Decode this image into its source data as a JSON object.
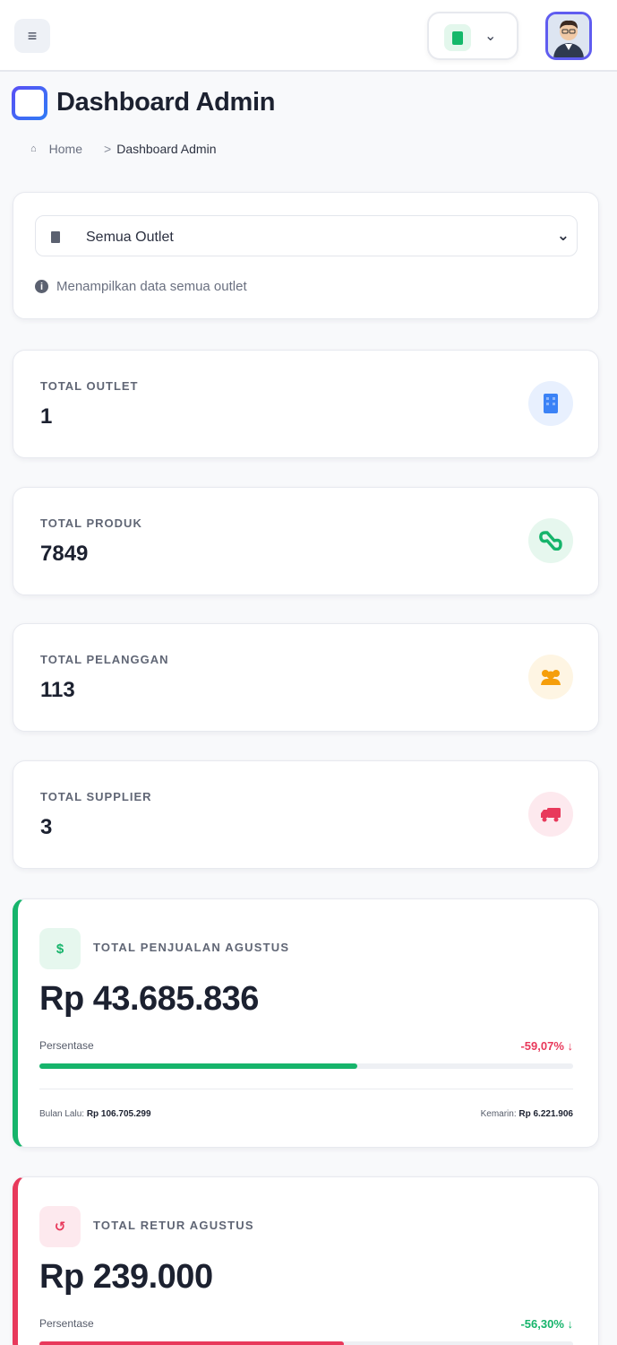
{
  "header": {
    "title": "Dashboard Admin",
    "breadcrumb": {
      "home": "Home",
      "separator": ">",
      "current": "Dashboard Admin"
    }
  },
  "icons": {
    "menu": "hamburger-icon",
    "outlet": "store-icon",
    "chevron": "chevron-down-icon",
    "avatar": "user-avatar",
    "title": "window-icon",
    "home": "home-icon",
    "info": "info-icon"
  },
  "filter": {
    "selected": "Semua Outlet",
    "info": "Menampilkan data semua outlet"
  },
  "stats": [
    {
      "label": "TOTAL OUTLET",
      "value": "1",
      "icon": "building-icon",
      "color": "#3b82f6",
      "bg": "#e8f0fe"
    },
    {
      "label": "TOTAL PRODUK",
      "value": "7849",
      "icon": "boxes-icon",
      "color": "#16b46b",
      "bg": "#e6f7ee"
    },
    {
      "label": "TOTAL PELANGGAN",
      "value": "113",
      "icon": "users-icon",
      "color": "#f59e0b",
      "bg": "#fef5e3"
    },
    {
      "label": "TOTAL SUPPLIER",
      "value": "3",
      "icon": "truck-icon",
      "color": "#e8395b",
      "bg": "#fde9ee"
    }
  ],
  "sales": {
    "icon_text": "$",
    "label": "TOTAL PENJUALAN AGUSTUS",
    "amount": "Rp 43.685.836",
    "pct_label": "Persentase",
    "pct": "-59,07%",
    "pct_arrow": "↓",
    "progress": 0.595,
    "color": "#16b46b",
    "foot_left_label": "Bulan Lalu:",
    "foot_left_value": "Rp 106.705.299",
    "foot_right_label": "Kemarin:",
    "foot_right_value": "Rp 6.221.906"
  },
  "retur": {
    "icon_text": "↺",
    "label": "TOTAL RETUR AGUSTUS",
    "amount": "Rp 239.000",
    "pct_label": "Persentase",
    "pct": "-56,30%",
    "pct_arrow": "↓",
    "progress": 0.57,
    "color": "#e8395b"
  }
}
